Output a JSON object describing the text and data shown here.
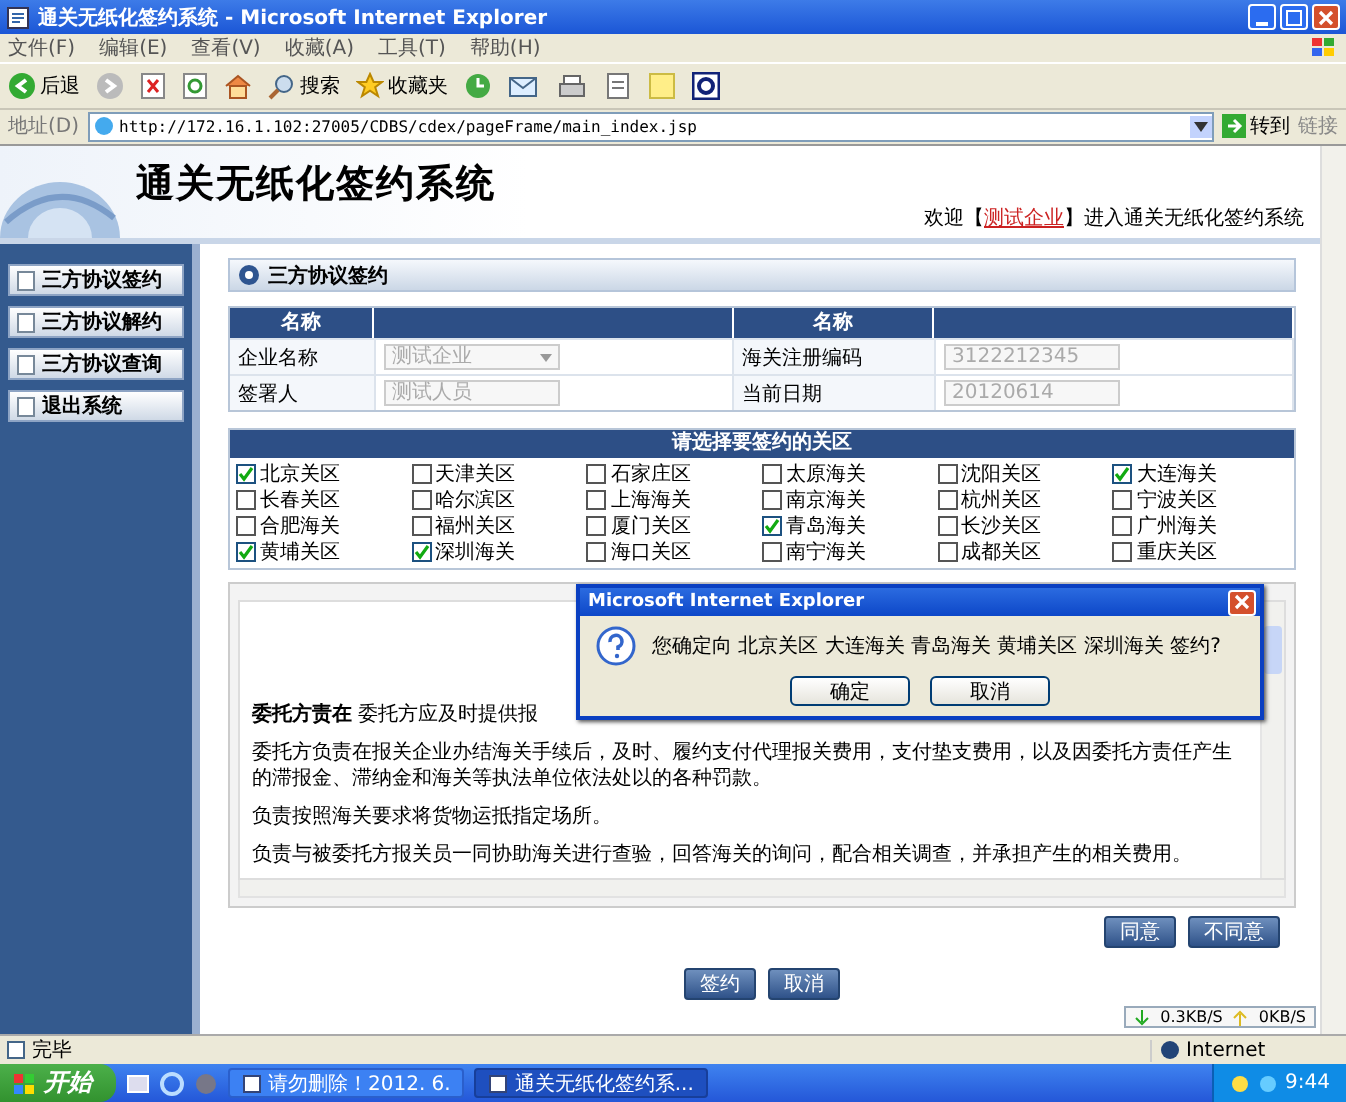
{
  "window": {
    "title": "通关无纸化签约系统 - Microsoft Internet Explorer"
  },
  "menu": [
    "文件(F)",
    "编辑(E)",
    "查看(V)",
    "收藏(A)",
    "工具(T)",
    "帮助(H)"
  ],
  "toolbar": {
    "back": "后退",
    "search": "搜索",
    "favorites": "收藏夹"
  },
  "address_bar": {
    "label": "地址(D)",
    "url": "http://172.16.1.102:27005/CDBS/cdex/pageFrame/main_index.jsp",
    "go": "转到",
    "links": "链接"
  },
  "header": {
    "title": "通关无纸化签约系统",
    "welcome_before": "欢迎【",
    "company": "测试企业",
    "welcome_after": "】进入通关无纸化签约系统"
  },
  "sidebar": {
    "items": [
      {
        "label": "三方协议签约"
      },
      {
        "label": "三方协议解约"
      },
      {
        "label": "三方协议查询"
      },
      {
        "label": "退出系统"
      }
    ]
  },
  "section_title": "三方协议签约",
  "form": {
    "columns": [
      "名称",
      "名称"
    ],
    "fields": [
      {
        "label": "企业名称",
        "value": "测试企业",
        "kind": "select",
        "disabled": true
      },
      {
        "label": "海关注册编码",
        "value": "3122212345",
        "kind": "text",
        "disabled": true
      },
      {
        "label": "签署人",
        "value": "测试人员",
        "kind": "text",
        "disabled": true
      },
      {
        "label": "当前日期",
        "value": "20120614",
        "kind": "text",
        "disabled": true
      }
    ]
  },
  "customs": {
    "title": "请选择要签约的关区",
    "items": [
      {
        "label": "北京关区",
        "checked": true
      },
      {
        "label": "天津关区",
        "checked": false
      },
      {
        "label": "石家庄区",
        "checked": false
      },
      {
        "label": "太原海关",
        "checked": false
      },
      {
        "label": "沈阳关区",
        "checked": false
      },
      {
        "label": "大连海关",
        "checked": true
      },
      {
        "label": "长春关区",
        "checked": false
      },
      {
        "label": "哈尔滨区",
        "checked": false
      },
      {
        "label": "上海海关",
        "checked": false
      },
      {
        "label": "南京海关",
        "checked": false
      },
      {
        "label": "杭州关区",
        "checked": false
      },
      {
        "label": "宁波关区",
        "checked": false
      },
      {
        "label": "合肥海关",
        "checked": false
      },
      {
        "label": "福州关区",
        "checked": false
      },
      {
        "label": "厦门关区",
        "checked": false
      },
      {
        "label": "青岛海关",
        "checked": true
      },
      {
        "label": "长沙关区",
        "checked": false
      },
      {
        "label": "广州海关",
        "checked": false
      },
      {
        "label": "黄埔关区",
        "checked": true
      },
      {
        "label": "深圳海关",
        "checked": true
      },
      {
        "label": "海口关区",
        "checked": false
      },
      {
        "label": "南宁海关",
        "checked": false
      },
      {
        "label": "成都关区",
        "checked": false
      },
      {
        "label": "重庆关区",
        "checked": false
      }
    ]
  },
  "agreement": {
    "paragraphs": [
      "**委托方责在** 委托方应及时提供报",
      "委托方负责在报关企业办结海关手续后，及时、履约支付代理报关费用，支付垫支费用，以及因委托方责任产生的滞报金、滞纳金和海关等执法单位依法处以的各种罚款。",
      "负责按照海关要求将货物运抵指定场所。",
      "负责与被委托方报关员一同协助海关进行查验，回答海关的询问，配合相关调查，并承担产生的相关费用。"
    ],
    "buttons": [
      "同意",
      "不同意"
    ]
  },
  "actions": [
    "签约",
    "取消"
  ],
  "dialog": {
    "title": "Microsoft Internet Explorer",
    "message": "您确定向 北京关区 大连海关 青岛海关 黄埔关区 深圳海关 签约?",
    "buttons": [
      "确定",
      "取消"
    ]
  },
  "net_speed": {
    "down": "0.3KB/S",
    "up": "0KB/S"
  },
  "status_bar": {
    "text": "完毕",
    "zone": "Internet"
  },
  "taskbar": {
    "start": "开始",
    "tasks": [
      {
        "label": "请勿删除！2012. 6.",
        "selected": false
      },
      {
        "label": "通关无纸化签约系...",
        "selected": true
      }
    ],
    "clock": "9:44"
  }
}
